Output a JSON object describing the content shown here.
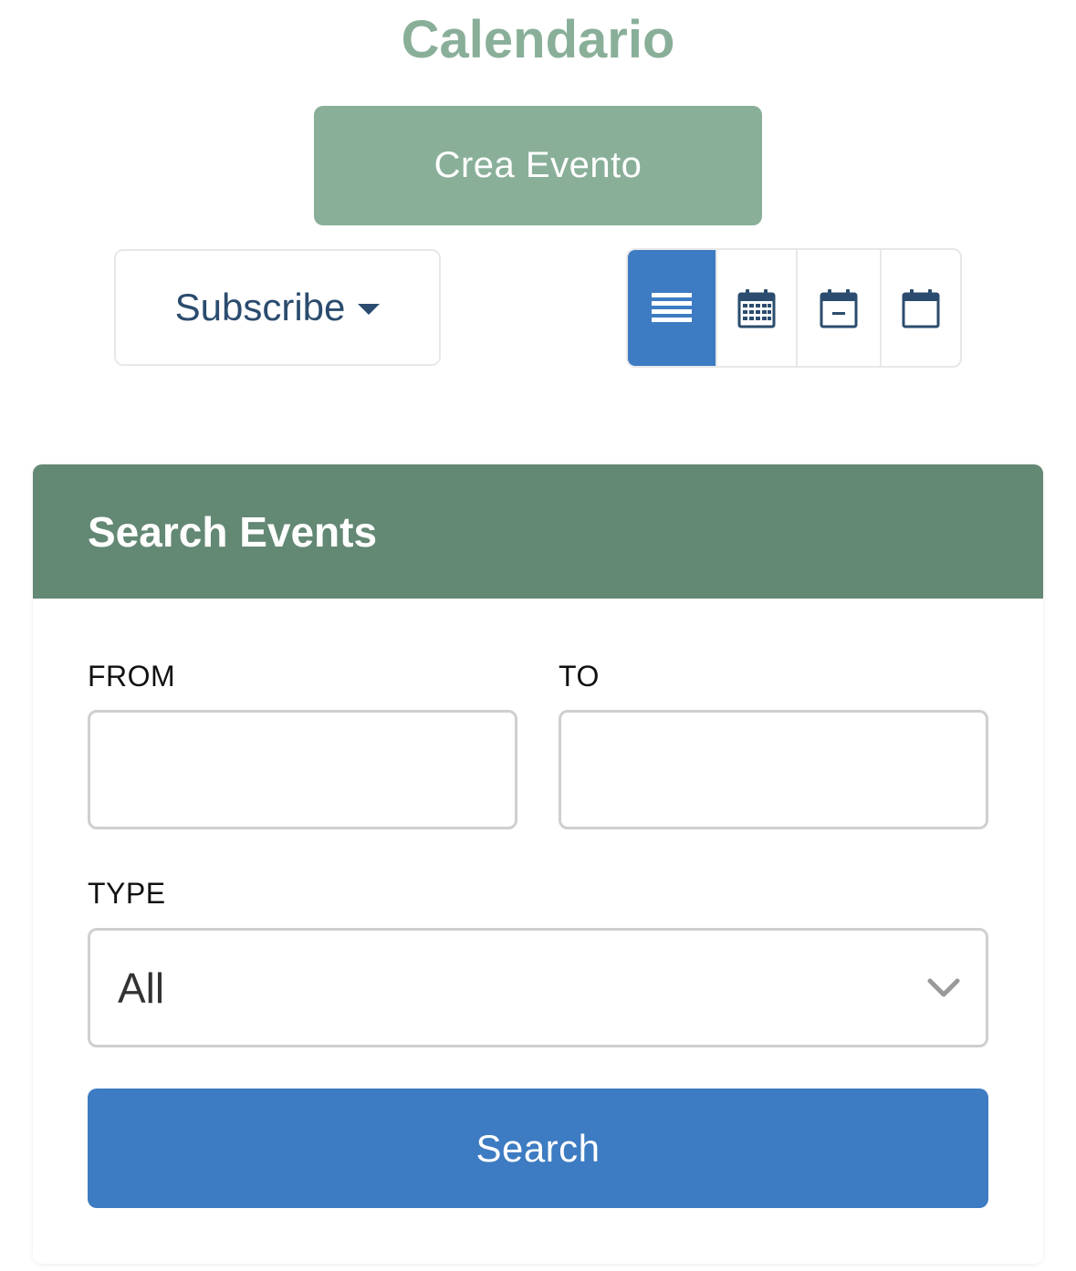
{
  "header": {
    "title": "Calendario",
    "create_button": "Crea Evento"
  },
  "toolbar": {
    "subscribe_label": "Subscribe",
    "views": [
      {
        "icon": "list-view-icon",
        "active": true
      },
      {
        "icon": "month-view-icon",
        "active": false
      },
      {
        "icon": "week-view-icon",
        "active": false
      },
      {
        "icon": "day-view-icon",
        "active": false
      }
    ]
  },
  "search": {
    "title": "Search Events",
    "from_label": "FROM",
    "from_value": "",
    "to_label": "TO",
    "to_value": "",
    "type_label": "TYPE",
    "type_selected": "All",
    "submit_label": "Search"
  },
  "colors": {
    "brand_green": "#89af99",
    "header_green": "#638874",
    "primary_blue": "#3d7bc2",
    "navy_text": "#2b4c6e"
  }
}
